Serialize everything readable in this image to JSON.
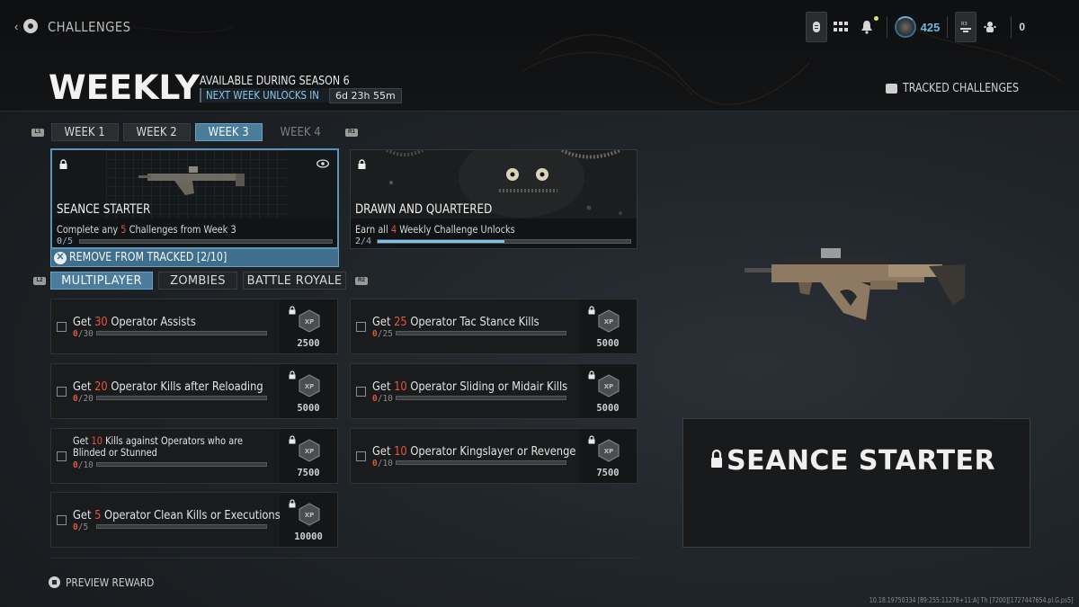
{
  "header": {
    "breadcrumb": "CHALLENGES",
    "title": "WEEKLY",
    "availability": "AVAILABLE DURING SEASON 6",
    "next_unlock_label": "NEXT WEEK UNLOCKS IN",
    "next_unlock_time": "6d 23h 55m",
    "tracked_challenges": "TRACKED CHALLENGES"
  },
  "topbar": {
    "icons": [
      "controller-icon",
      "grid-menu-icon",
      "notification-bell-icon",
      "player-level-icon",
      "r3-social-icon",
      "party-icon"
    ],
    "level": "425",
    "party_count": "0",
    "notification_dot_color": "#d8e75a"
  },
  "bumpers": {
    "left_week": "L1",
    "right_week": "R1",
    "left_mode": "L2",
    "right_mode": "R2"
  },
  "weeks": [
    {
      "label": "WEEK 1",
      "state": "normal"
    },
    {
      "label": "WEEK 2",
      "state": "normal"
    },
    {
      "label": "WEEK 3",
      "state": "active"
    },
    {
      "label": "WEEK 4",
      "state": "disabled"
    }
  ],
  "rewards": [
    {
      "name": "SEANCE STARTER",
      "desc_pre": "Complete any ",
      "desc_num": "5",
      "desc_post": " Challenges from Week 3",
      "progress_current": "0",
      "progress_total": "/5",
      "progress_fraction": 0,
      "locked": true,
      "selected": true
    },
    {
      "name": "DRAWN AND QUARTERED",
      "desc_pre": "Earn all ",
      "desc_num": "4",
      "desc_post": " Weekly Challenge Unlocks",
      "progress_current": "2",
      "progress_total": "/4",
      "progress_fraction": 0.5,
      "locked": true,
      "selected": false
    }
  ],
  "tracked_action": "REMOVE FROM TRACKED [2/10]",
  "modes": [
    {
      "label": "MULTIPLAYER",
      "active": true
    },
    {
      "label": "ZOMBIES",
      "active": false
    },
    {
      "label": "BATTLE ROYALE",
      "active": false
    }
  ],
  "challenges": [
    {
      "pre": "Get ",
      "num": "30",
      "post": " Operator Assists",
      "line2": "",
      "cur": "0",
      "total": "/30",
      "xp": "2500"
    },
    {
      "pre": "Get ",
      "num": "25",
      "post": " Operator Tac Stance Kills",
      "line2": "",
      "cur": "0",
      "total": "/25",
      "xp": "5000"
    },
    {
      "pre": "Get ",
      "num": "20",
      "post": " Operator Kills after Reloading",
      "line2": "",
      "cur": "0",
      "total": "/20",
      "xp": "5000"
    },
    {
      "pre": "Get ",
      "num": "10",
      "post": " Operator Sliding or Midair Kills",
      "line2": "",
      "cur": "0",
      "total": "/10",
      "xp": "5000"
    },
    {
      "pre": "Get ",
      "num": "10",
      "post": " Kills against Operators who are",
      "line2": "Blinded or Stunned",
      "cur": "0",
      "total": "/10",
      "xp": "7500"
    },
    {
      "pre": "Get ",
      "num": "10",
      "post": " Operator Kingslayer or Revenge Kills",
      "line2": "",
      "cur": "0",
      "total": "/10",
      "xp": "7500"
    },
    {
      "pre": "Get ",
      "num": "5",
      "post": " Operator Clean Kills or Executions",
      "line2": "",
      "cur": "0",
      "total": "/5",
      "xp": "10000"
    }
  ],
  "preview_reward": "PREVIEW REWARD",
  "detail": {
    "reward_title": "SEANCE STARTER"
  },
  "build_info": "10.18.19750334 [89:255:11278+11:A] Th [7200][1727447654.pl.G.ps5]",
  "colors": {
    "accent": "#4b7c9a",
    "highlight_number": "#e0573f",
    "progress_fill": "#7cc3ea"
  }
}
